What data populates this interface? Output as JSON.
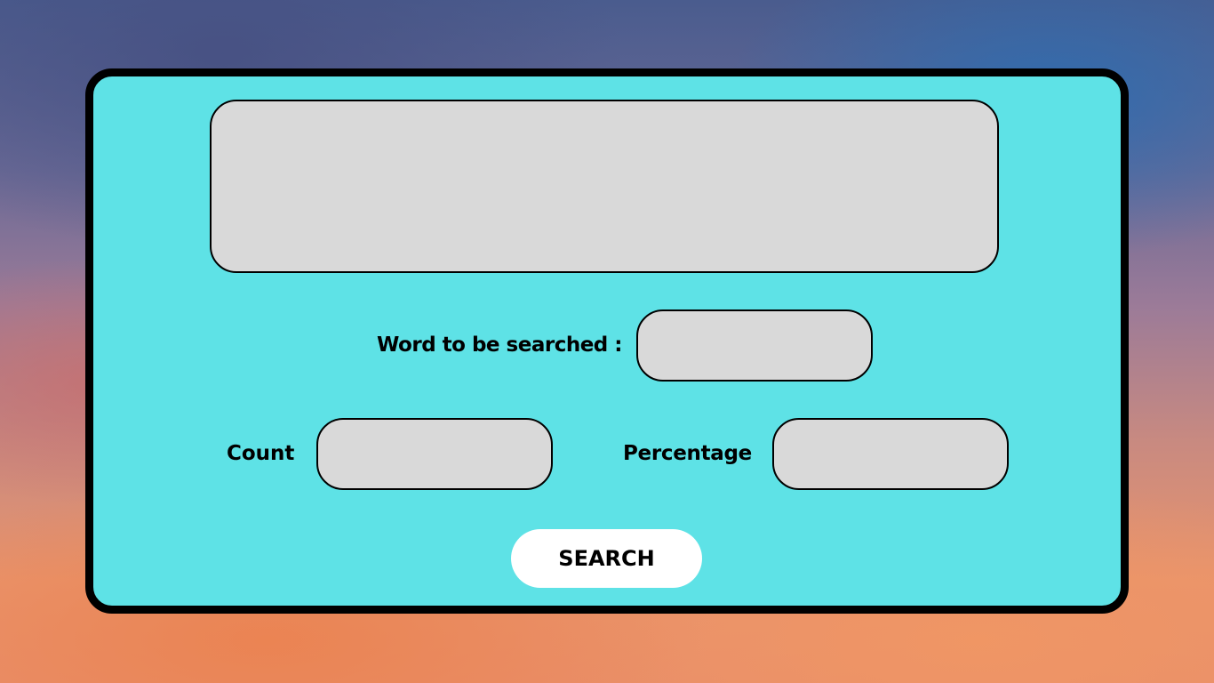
{
  "form": {
    "text_area_value": "",
    "word_label": "Word to be searched :",
    "word_value": "",
    "count_label": "Count",
    "count_value": "",
    "percentage_label": "Percentage",
    "percentage_value": "",
    "search_label": "SEARCH"
  },
  "colors": {
    "card_background": "#5ee2e6",
    "field_background": "#d9d9d9",
    "border": "#000000",
    "button_background": "#ffffff"
  }
}
